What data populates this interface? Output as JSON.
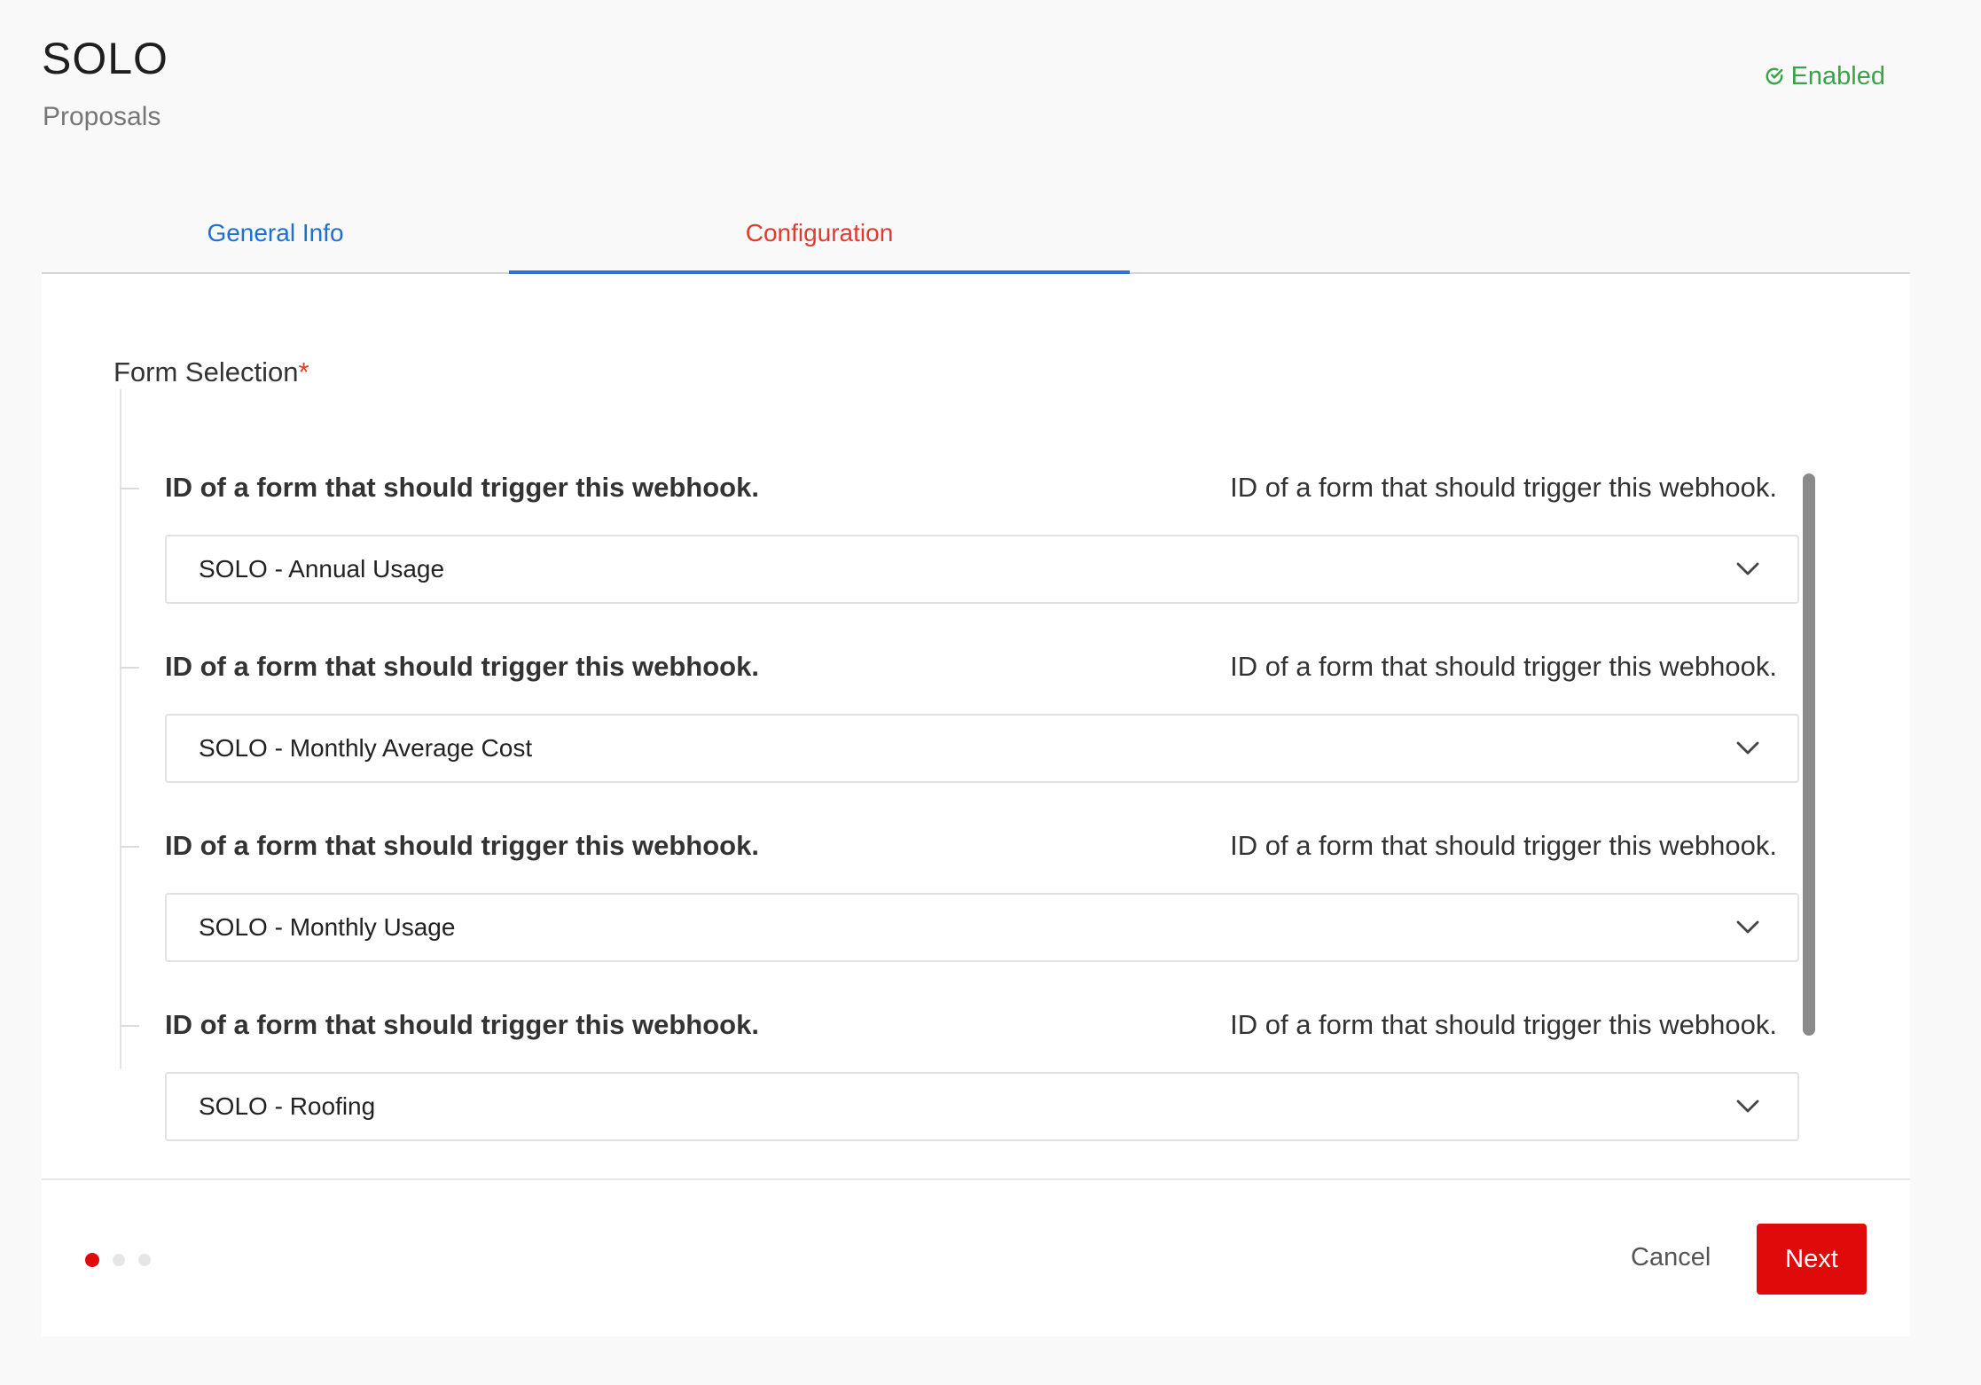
{
  "header": {
    "title": "SOLO",
    "subtitle": "Proposals",
    "status_label": "Enabled",
    "status_icon": "check-circle-icon",
    "status_color": "#3aa34a"
  },
  "tabs": [
    {
      "label": "General Info",
      "color": "#1f6fd1"
    },
    {
      "label": "Configuration",
      "active": true,
      "color": "#e23b2e"
    }
  ],
  "form": {
    "section_label": "Form Selection",
    "required_mark": "*",
    "fields": [
      {
        "label": "ID of a form that should trigger this webhook.",
        "help": "ID of a form that should trigger this webhook.",
        "value": "SOLO - Annual Usage"
      },
      {
        "label": "ID of a form that should trigger this webhook.",
        "help": "ID of a form that should trigger this webhook.",
        "value": "SOLO - Monthly Average Cost"
      },
      {
        "label": "ID of a form that should trigger this webhook.",
        "help": "ID of a form that should trigger this webhook.",
        "value": "SOLO - Monthly Usage"
      },
      {
        "label": "ID of a form that should trigger this webhook.",
        "help": "ID of a form that should trigger this webhook.",
        "value": "SOLO - Roofing"
      }
    ]
  },
  "footer": {
    "steps_total": 3,
    "current_step": 1,
    "cancel_label": "Cancel",
    "next_label": "Next",
    "accent_color": "#e00a0a"
  }
}
